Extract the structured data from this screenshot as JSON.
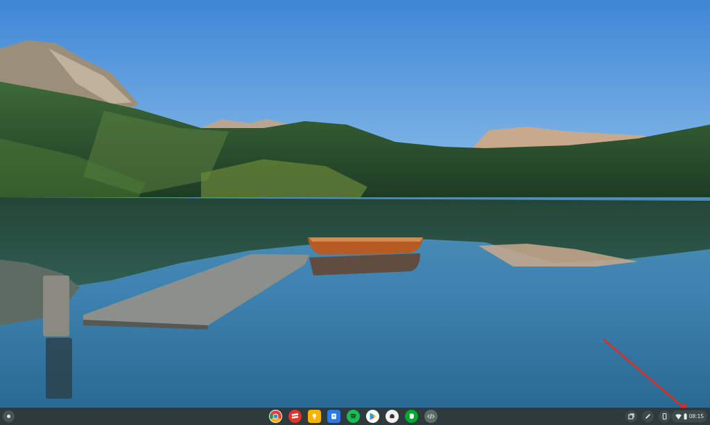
{
  "shelf": {
    "apps": [
      {
        "name": "chrome-icon"
      },
      {
        "name": "files-red-icon"
      },
      {
        "name": "keep-icon"
      },
      {
        "name": "docs-icon"
      },
      {
        "name": "spotify-icon"
      },
      {
        "name": "play-store-icon"
      },
      {
        "name": "app-white-icon"
      },
      {
        "name": "evernote-icon"
      },
      {
        "name": "dev-tools-icon"
      }
    ],
    "tray": [
      "overview-icon",
      "stylus-icon",
      "phone-hub-icon"
    ],
    "status": {
      "clock": "08:15",
      "icons": [
        "wifi-icon",
        "battery-icon"
      ]
    }
  },
  "colors": {
    "shelf_bg": "#2f3a3c",
    "annotation_arrow": "#e8291c"
  }
}
